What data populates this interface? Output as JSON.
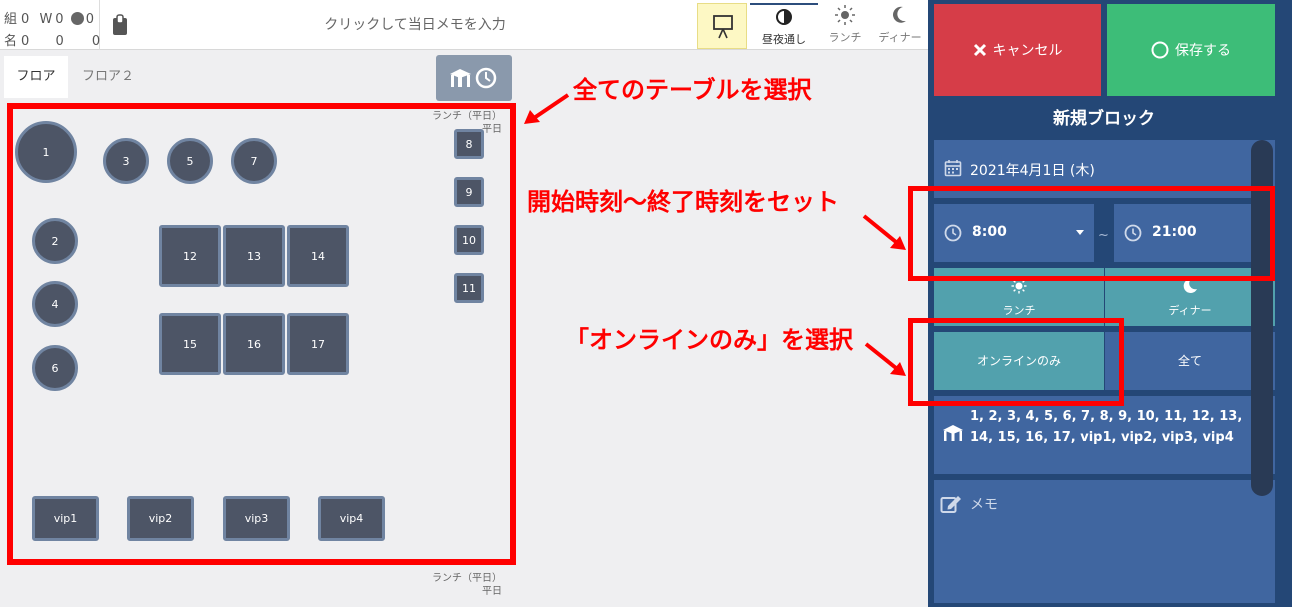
{
  "stats": {
    "row1": {
      "groups_label": "組",
      "groups": "0",
      "walkin_label": "W",
      "walkin": "0",
      "web": "0"
    },
    "row2": {
      "people_label": "名",
      "people": "0",
      "walkin": "0",
      "web": "0"
    }
  },
  "memo": {
    "placeholder": "クリックして当日メモを入力"
  },
  "modes": [
    {
      "label": "昼夜通し",
      "icon": "half-moon-icon",
      "active": true
    },
    {
      "label": "ランチ",
      "icon": "sun-icon"
    },
    {
      "label": "ディナー",
      "icon": "moon-icon"
    }
  ],
  "tabs": [
    "フロア",
    "フロア２"
  ],
  "floor": {
    "period_top": "ランチ（平日）\n平日",
    "period_bottom": "ランチ（平日）\n平日",
    "round_tables": [
      "1",
      "3",
      "5",
      "7",
      "2",
      "4",
      "6"
    ],
    "square_tables": [
      "12",
      "13",
      "14",
      "15",
      "16",
      "17",
      "8",
      "9",
      "10",
      "11"
    ],
    "vip_tables": [
      "vip1",
      "vip2",
      "vip3",
      "vip4"
    ]
  },
  "annotations": {
    "select_all": "全てのテーブルを選択",
    "set_time": "開始時刻～終了時刻をセット",
    "online_only": "「オンラインのみ」を選択"
  },
  "panel": {
    "cancel_label": "キャンセル",
    "save_label": "保存する",
    "title": "新規ブロック",
    "date": "2021年4月1日 (木)",
    "start_time": "8:00",
    "end_time": "21:00",
    "tilde": "~",
    "lunch_label": "ランチ",
    "dinner_label": "ディナー",
    "online_label": "オンラインのみ",
    "all_label": "全て",
    "tables": "1, 2, 3, 4, 5, 6, 7, 8, 9, 10, 11, 12, 13, 14, 15, 16, 17, vip1, vip2, vip3, vip4",
    "memo_placeholder": "メモ"
  },
  "colors": {
    "panel_bg": "#244776",
    "card_bg": "#4066a0",
    "teal": "#52a1ad",
    "cancel": "#d63d48",
    "save": "#3dbd78",
    "table_fill": "#4d5566",
    "annotation_red": "#ff0000"
  }
}
